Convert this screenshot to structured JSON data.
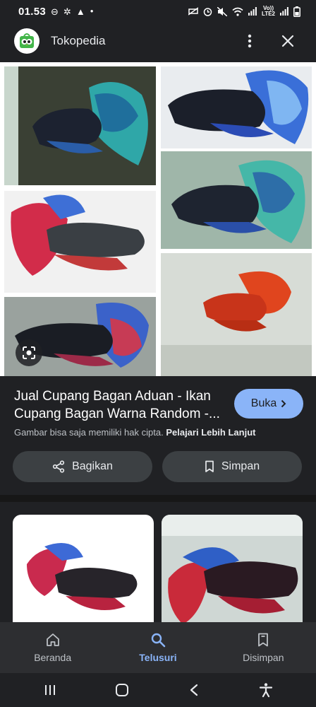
{
  "status_bar": {
    "time": "01.53",
    "left_icons": [
      "do-not-disturb-icon",
      "settings-icon",
      "warning-icon",
      "dot-icon"
    ],
    "right_icons": [
      "silent-icon",
      "alarm-icon",
      "mute-icon",
      "wifi-icon",
      "signal-icon",
      "volte-icon",
      "signal-icon",
      "battery-icon"
    ],
    "volte_label": "Vo))\nLTE2"
  },
  "header": {
    "site_name": "Tokopedia",
    "logo_icon": "tokopedia-owl-icon",
    "menu_icon": "more-vertical-icon",
    "close_icon": "close-icon"
  },
  "result": {
    "title": "Jual Cupang Bagan Aduan - Ikan\nCupang Bagan Warna Random -...",
    "visit_label": "Buka",
    "copyright_text": "Gambar bisa saja memiliki hak cipta.",
    "learn_more_label": "Pelajari Lebih Lanjut",
    "share_label": "Bagikan",
    "save_label": "Simpan"
  },
  "bottom_nav": {
    "items": [
      {
        "label": "Beranda",
        "icon": "home-icon",
        "active": false
      },
      {
        "label": "Telusuri",
        "icon": "search-icon",
        "active": true
      },
      {
        "label": "Disimpan",
        "icon": "collections-icon",
        "active": false
      }
    ]
  },
  "system_nav": {
    "icons": [
      "recent-apps-icon",
      "home-button-icon",
      "back-icon",
      "accessibility-icon"
    ]
  },
  "colors": {
    "background": "#202124",
    "accent": "#8ab4f8",
    "button": "#3c4043",
    "nav_bar": "#2d2e31"
  }
}
